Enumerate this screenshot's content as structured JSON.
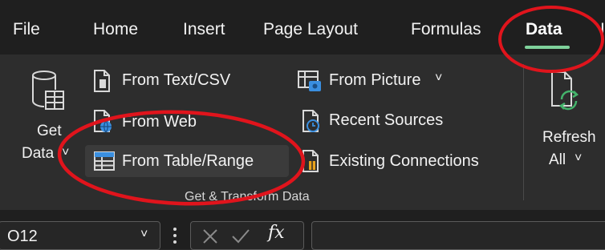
{
  "tabs": {
    "file": "File",
    "home": "Home",
    "insert": "Insert",
    "page_layout": "Page Layout",
    "formulas": "Formulas",
    "data": "Data",
    "next_partial": "I"
  },
  "get_data": {
    "line1": "Get",
    "line2": "Data",
    "chevron": "˅"
  },
  "commands": {
    "from_text_csv": "From Text/CSV",
    "from_web": "From Web",
    "from_table_range": "From Table/Range",
    "from_picture": "From Picture",
    "from_picture_chevron": "˅",
    "recent_sources": "Recent Sources",
    "existing_connections": "Existing Connections"
  },
  "refresh_all": {
    "line1": "Refresh",
    "line2": "All",
    "chevron": "˅"
  },
  "group_label": "Get & Transform Data",
  "formula_bar": {
    "name_box_value": "O12",
    "fx_label": "fx"
  },
  "colors": {
    "accent_underline": "#7fd19b",
    "annotation_red": "#e0141c",
    "ribbon_bg": "#2d2d2d",
    "tabbar_bg": "#1f1f1f"
  }
}
